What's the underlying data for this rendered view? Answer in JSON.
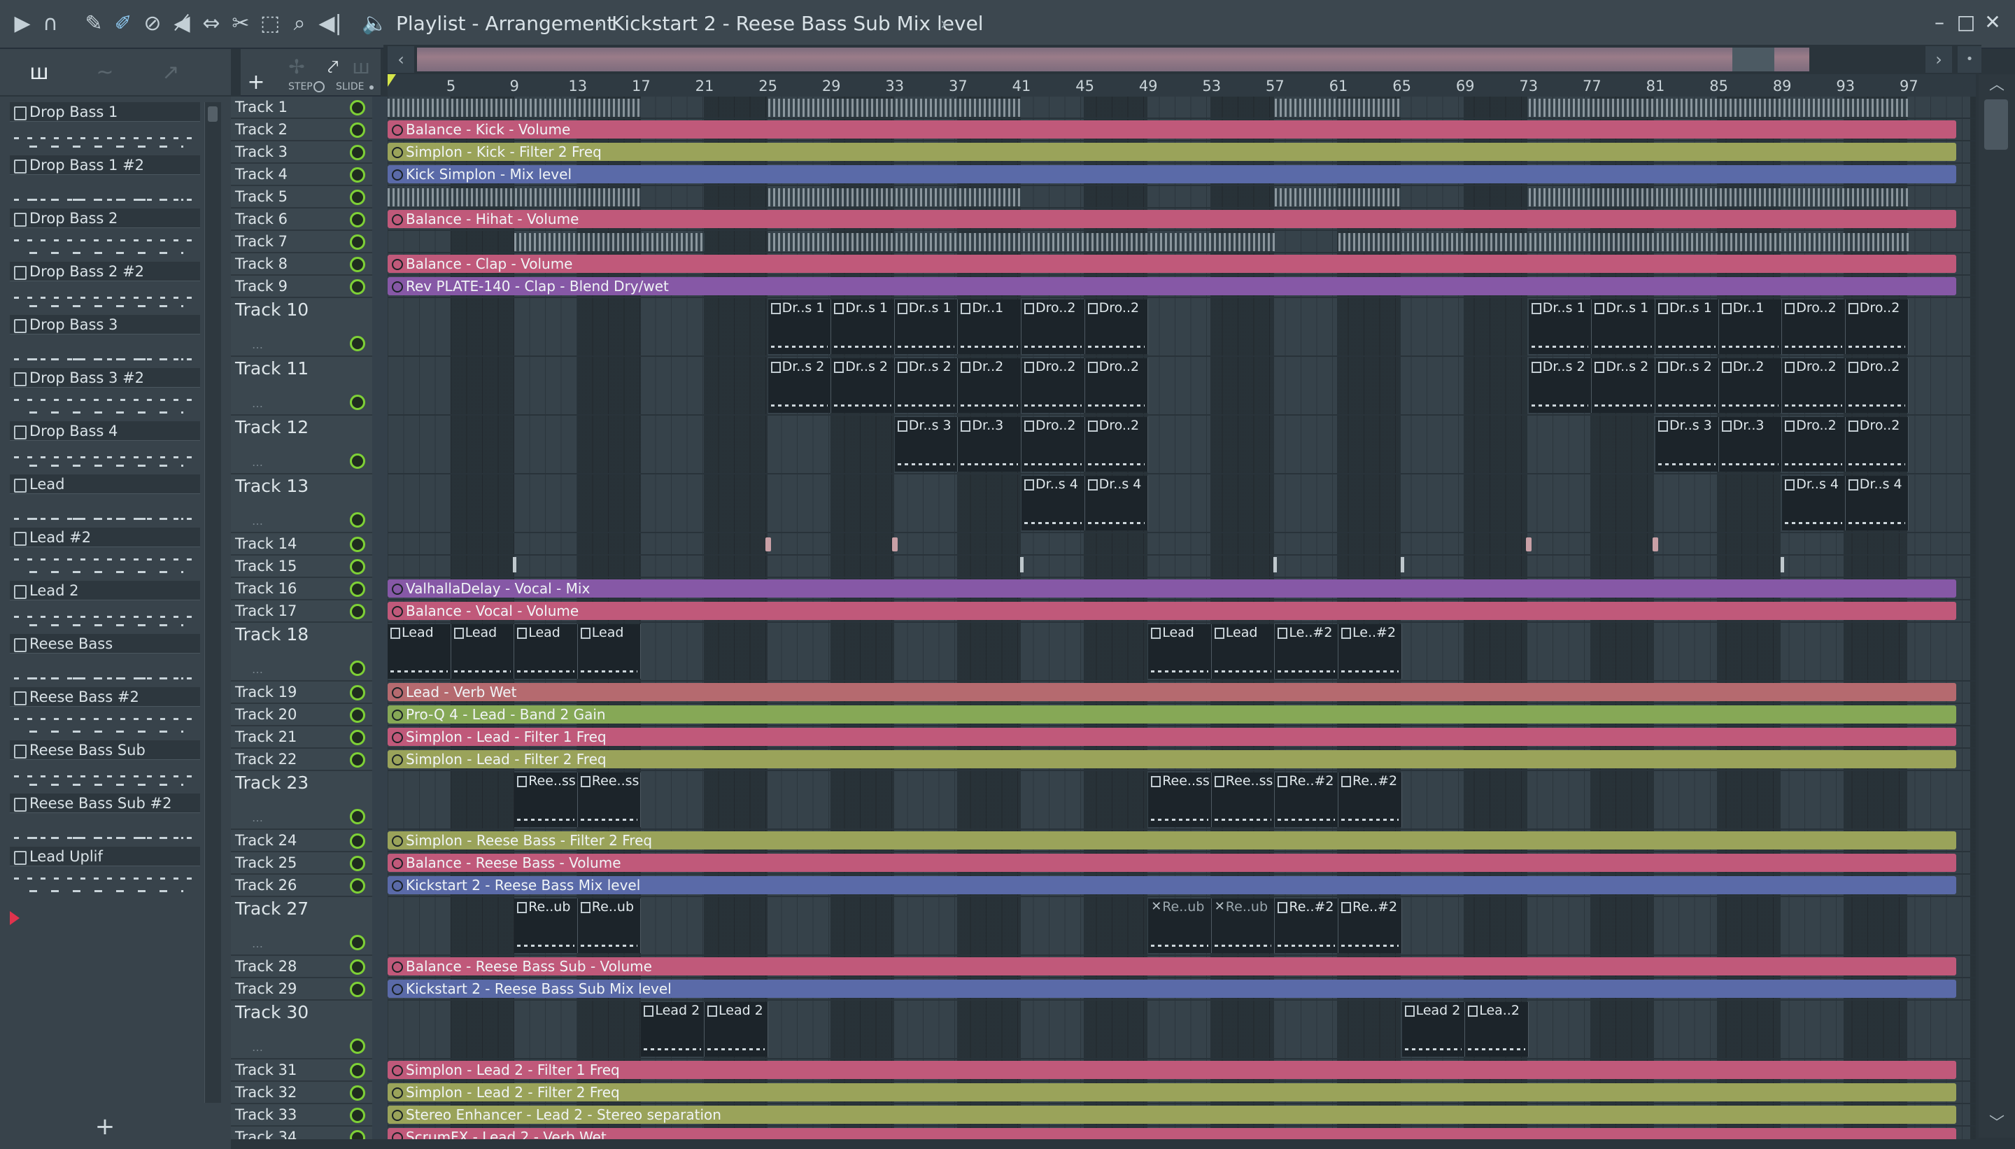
{
  "window": {
    "breadcrumb": [
      "Playlist - Arrangement",
      "Kickstart 2 - Reese Bass Sub Mix level"
    ],
    "separator": "›",
    "controls": {
      "minimize": "–",
      "maximize": "□",
      "close": "✕"
    }
  },
  "toolbar_icons": [
    "play-arrow-icon",
    "magnet-icon",
    "pencil-icon",
    "paint-brush-icon",
    "delete-icon",
    "mute-icon",
    "slip-icon",
    "slice-icon",
    "select-icon",
    "zoom-icon",
    "playback-icon",
    "speaker-icon"
  ],
  "toolbar_symbols": [
    "▶",
    "∩",
    "✎",
    "✐",
    "⊘",
    "◀̸",
    "⇔",
    "✂",
    "⬚",
    "⌕",
    "◀|",
    "🔈"
  ],
  "browser": {
    "header_icons": [
      "piano-roll-icon",
      "wave-icon",
      "curve-icon"
    ],
    "header_symbols": [
      "ш",
      "~",
      "↗"
    ],
    "patterns": [
      "Drop Bass 1",
      "Drop Bass 1 #2",
      "Drop Bass 2",
      "Drop Bass 2 #2",
      "Drop Bass 3",
      "Drop Bass 3 #2",
      "Drop Bass 4",
      "Lead",
      "Lead #2",
      "Lead 2",
      "Reese Bass",
      "Reese Bass #2",
      "Reese Bass Sub",
      "Reese Bass Sub #2",
      "Lead Uplif"
    ],
    "add_label": "+"
  },
  "playlist_tools": {
    "step_label": "STEP",
    "slide_label": "SLIDE",
    "add_track": "+"
  },
  "ruler": {
    "bars": [
      "5",
      "9",
      "13",
      "17",
      "21",
      "25",
      "29",
      "33",
      "37",
      "41",
      "45",
      "49",
      "53",
      "57",
      "61",
      "65",
      "69",
      "73",
      "77",
      "81",
      "85",
      "89",
      "93",
      "97"
    ]
  },
  "overview": {
    "left": "‹",
    "right": "›",
    "far": "•"
  },
  "tracks": [
    "Track 1",
    "Track 2",
    "Track 3",
    "Track 4",
    "Track 5",
    "Track 6",
    "Track 7",
    "Track 8",
    "Track 9",
    "Track 10",
    "Track 11",
    "Track 12",
    "Track 13",
    "Track 14",
    "Track 15",
    "Track 16",
    "Track 17",
    "Track 18",
    "Track 19",
    "Track 20",
    "Track 21",
    "Track 22",
    "Track 23",
    "Track 24",
    "Track 25",
    "Track 26",
    "Track 27",
    "Track 28",
    "Track 29",
    "Track 30",
    "Track 31",
    "Track 32",
    "Track 33",
    "Track 34"
  ],
  "automation": {
    "t2": "Balance - Kick - Volume",
    "t3": "Simplon - Kick - Filter 2 Freq",
    "t4": "Kick Simplon - Mix level",
    "t6": "Balance - Hihat - Volume",
    "t8": "Balance - Clap - Volume",
    "t9": "Rev PLATE-140 - Clap - Blend Dry/wet",
    "t16": "ValhallaDelay - Vocal - Mix",
    "t17": "Balance - Vocal - Volume",
    "t19": "Lead - Verb Wet",
    "t20": "Pro-Q 4 - Lead - Band 2 Gain",
    "t21": "Simplon - Lead - Filter 1 Freq",
    "t22": "Simplon - Lead - Filter 2 Freq",
    "t24": "Simplon - Reese Bass - Filter 2 Freq",
    "t25": "Balance - Reese Bass - Volume",
    "t26": "Kickstart 2 - Reese Bass Mix level",
    "t28": "Balance - Reese Bass Sub - Volume",
    "t29": "Kickstart 2 - Reese Bass Sub Mix level",
    "t31": "Simplon - Lead 2 - Filter 1 Freq",
    "t32": "Simplon - Lead 2 - Filter 2 Freq",
    "t33": "Stereo Enhancer - Lead 2 - Stereo separation",
    "t34": "ScrumFX - Lead 2 - Verb Wet"
  },
  "clip_labels": {
    "drs1": "Dr..s 1",
    "dr1": "Dr..1",
    "dro2": "Dro..2",
    "drs2": "Dr..s 2",
    "dr2": "Dr..2",
    "drs3": "Dr..s 3",
    "dr3": "Dr..3",
    "drs4": "Dr..s 4",
    "lead": "Lead",
    "le2": "Le..#2",
    "ress": "Ree..ss",
    "re2": "Re..#2",
    "reub": "Re..ub",
    "lead2": "Lead 2",
    "lea2": "Lea..2"
  },
  "colors": {
    "pink": "#c0597a",
    "olive": "#9aa35a",
    "blue": "#5a6aa8",
    "purple": "#8658a6",
    "salmon": "#b56a6f",
    "green": "#86a856",
    "track_on": "#7ed036"
  }
}
